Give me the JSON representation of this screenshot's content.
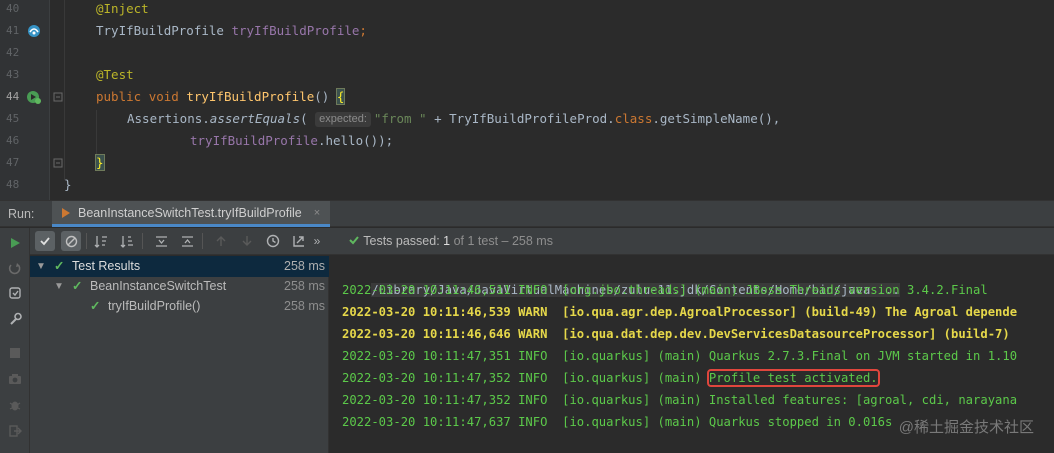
{
  "editor": {
    "lines": [
      {
        "num": "40",
        "current": false
      },
      {
        "num": "41",
        "current": false
      },
      {
        "num": "42",
        "current": false
      },
      {
        "num": "43",
        "current": false
      },
      {
        "num": "44",
        "current": true
      },
      {
        "num": "45",
        "current": false
      },
      {
        "num": "46",
        "current": false
      },
      {
        "num": "47",
        "current": false
      },
      {
        "num": "48",
        "current": false
      }
    ],
    "l40_ann": "@Inject",
    "l41_type": "TryIfBuildProfile",
    "l41_field": "tryIfBuildProfile",
    "l41_semi": ";",
    "l43_ann": "@Test",
    "l44_public": "public",
    "l44_void": "void",
    "l44_method": "tryIfBuildProfile",
    "l44_parens": "()",
    "l44_brace": "{",
    "l45_class": "Assertions.",
    "l45_method": "assertEquals",
    "l45_open": "(",
    "l45_hint": "expected:",
    "l45_str": "\"from \"",
    "l45_plus": " + TryIfBuildProfileProd.",
    "l45_class_kw": "class",
    "l45_rest": ".getSimpleName(),",
    "l46_field": "tryIfBuildProfile",
    "l46_rest": ".hello());",
    "l47_brace": "}",
    "l48_brace": "}"
  },
  "runbar": {
    "label": "Run:",
    "tab_title": "BeanInstanceSwitchTest.tryIfBuildProfile",
    "tab_close": "×"
  },
  "status": {
    "passed_label": "Tests passed:",
    "passed_count": "1",
    "rest": "of 1 test – 258 ms"
  },
  "tree": [
    {
      "label": "Test Results",
      "time": "258 ms",
      "selected": true
    },
    {
      "label": "BeanInstanceSwitchTest",
      "time": "258 ms",
      "selected": false
    },
    {
      "label": "tryIfBuildProfile()",
      "time": "258 ms",
      "selected": false
    }
  ],
  "console": {
    "path": "/Library/Java/JavaVirtualMachines/zulu-11.jdk/Contents/Home/bin/java ...",
    "lines": [
      {
        "text": "2022-03-20 10:11:46,511 INFO  [org.jbo.threads] (main) JBoss Threads version 3.4.2.Final",
        "level": "info"
      },
      {
        "text": "2022-03-20 10:11:46,539 WARN  [io.qua.agr.dep.AgroalProcessor] (build-49) The Agroal depende",
        "level": "warn"
      },
      {
        "text": "2022-03-20 10:11:46,646 WARN  [io.qua.dat.dep.dev.DevServicesDatasourceProcessor] (build-7)",
        "level": "warn"
      },
      {
        "text": "2022-03-20 10:11:47,351 INFO  [io.quarkus] (main) Quarkus 2.7.3.Final on JVM started in 1.10",
        "level": "info"
      },
      {
        "text": "2022-03-20 10:11:47,352 INFO  [io.quarkus] (main) ",
        "level": "info",
        "highlight": "Profile test activated."
      },
      {
        "text": "2022-03-20 10:11:47,352 INFO  [io.quarkus] (main) Installed features: [agroal, cdi, narayana",
        "level": "info"
      },
      {
        "text": "2022-03-20 10:11:47,637 INFO  [io.quarkus] (main) Quarkus stopped in 0.016s",
        "level": "info"
      }
    ]
  },
  "watermark": "@稀土掘金技术社区",
  "colors": {
    "pass_green": "#5fb85f",
    "console_info": "#5cc94a",
    "console_warn": "#e6d84a",
    "highlight_box": "#e0463d",
    "tab_underline": "#4a88c7"
  },
  "icons": [
    "run-icon",
    "rerun-failed-icon",
    "toggle-auto-test-icon",
    "settings-wrench-icon",
    "stop-icon",
    "camera-icon",
    "debug-icon",
    "sign-out-icon",
    "show-passed-icon",
    "show-ignored-icon",
    "sort-alpha-icon",
    "sort-duration-icon",
    "expand-all-icon",
    "collapse-all-icon",
    "prev-fail-icon",
    "next-fail-icon",
    "history-icon",
    "export-icon",
    "more-icon",
    "pass-check-icon"
  ]
}
